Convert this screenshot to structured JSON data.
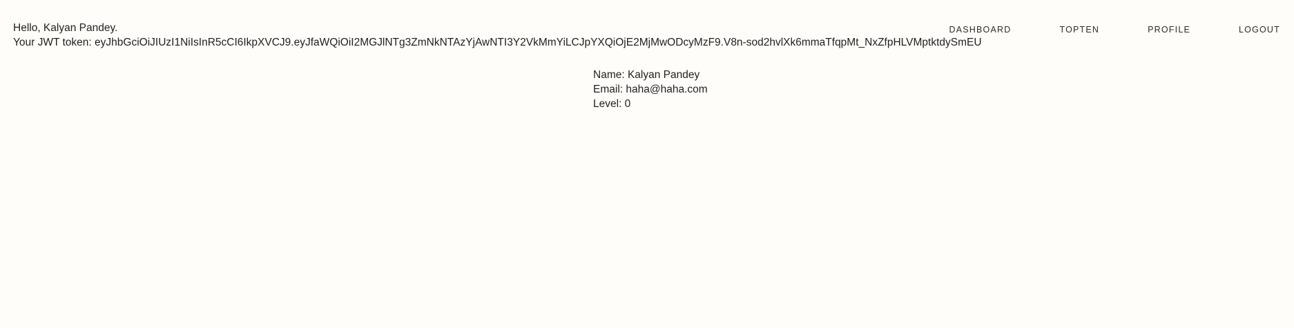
{
  "header": {
    "greeting": "Hello, Kalyan Pandey.",
    "token_label": "Your JWT token: ",
    "token_value": "eyJhbGciOiJIUzI1NiIsInR5cCI6IkpXVCJ9.eyJfaWQiOiI2MGJlNTg3ZmNkNTAzYjAwNTI3Y2VkMmYiLCJpYXQiOjE2MjMwODcyMzF9.V8n-sod2hvlXk6mmaTfqpMt_NxZfpHLVMptktdySmEU"
  },
  "nav": {
    "items": [
      {
        "label": "DASHBOARD"
      },
      {
        "label": "TOPTEN"
      },
      {
        "label": "PROFILE"
      },
      {
        "label": "LOGOUT"
      }
    ]
  },
  "profile": {
    "name": "Name: Kalyan Pandey",
    "email": "Email: haha@haha.com",
    "level": "Level: 0"
  }
}
